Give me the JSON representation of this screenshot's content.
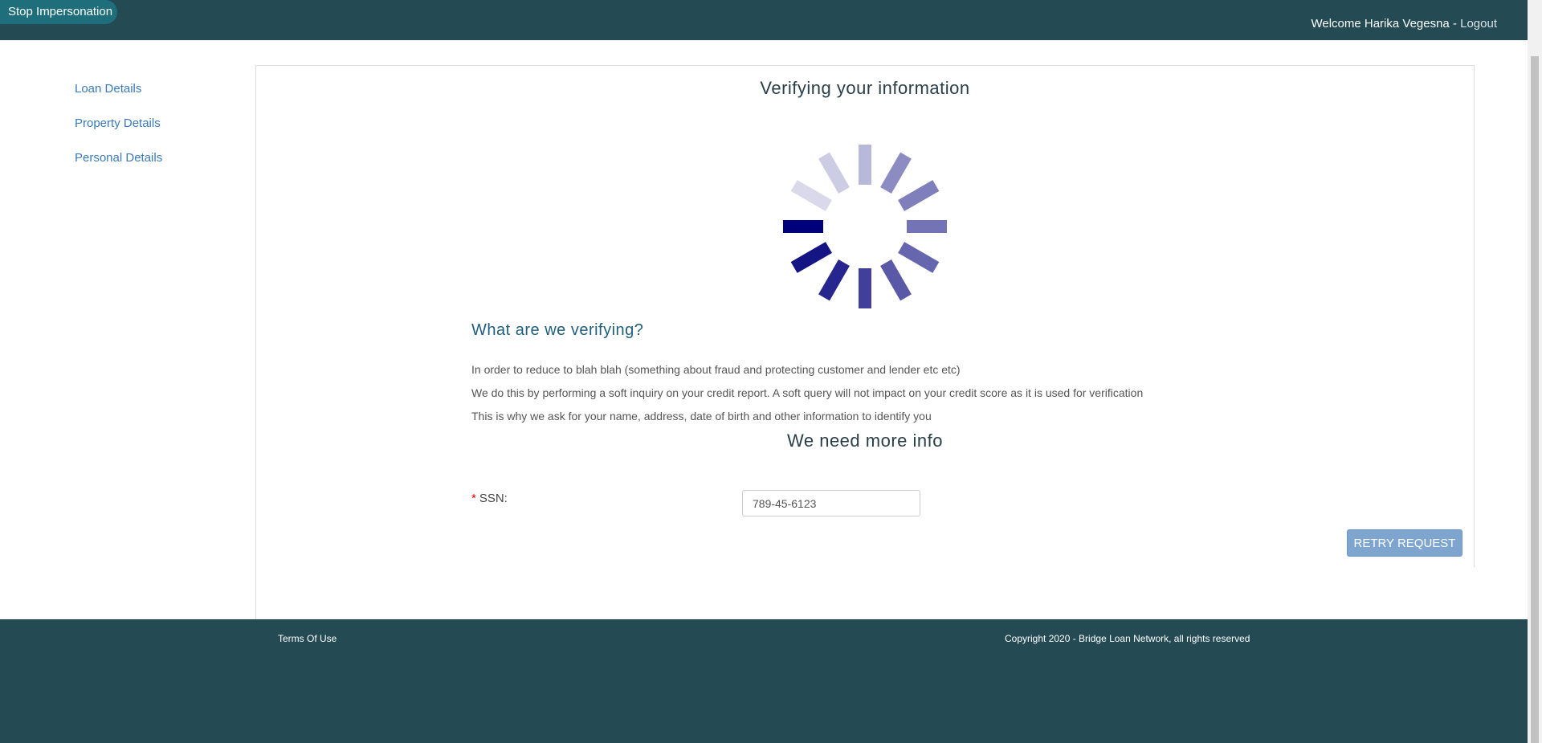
{
  "header": {
    "stop_impersonation": "Stop Impersonation",
    "welcome": "Welcome Harika Vegesna - ",
    "logout": "Logout"
  },
  "sidebar": {
    "items": [
      {
        "label": "Loan Details"
      },
      {
        "label": "Property Details"
      },
      {
        "label": "Personal Details"
      }
    ]
  },
  "main": {
    "title": "Verifying your information",
    "section_title": "What are we verifying?",
    "paragraphs": [
      "In order to reduce to blah blah (something about fraud and protecting customer and lender etc etc)",
      "We do this by performing a soft inquiry on your credit report. A soft query will not impact on your credit score as it is used for verification",
      "This is why we ask for your name, address, date of birth and other information to identify you"
    ],
    "more_info_title": "We need more info",
    "ssn_required_mark": "*",
    "ssn_label": "SSN:",
    "ssn_value": "789-45-6123",
    "retry_label": "RETRY REQUEST"
  },
  "footer": {
    "terms": "Terms Of Use",
    "copyright": "Copyright 2020 - Bridge Loan Network, all rights reserved"
  },
  "colors": {
    "header_bg": "#244a54",
    "accent": "#1e6f7b",
    "link": "#3a7ab8",
    "spinner": "#00007a",
    "retry_button": "#7da5cf"
  }
}
